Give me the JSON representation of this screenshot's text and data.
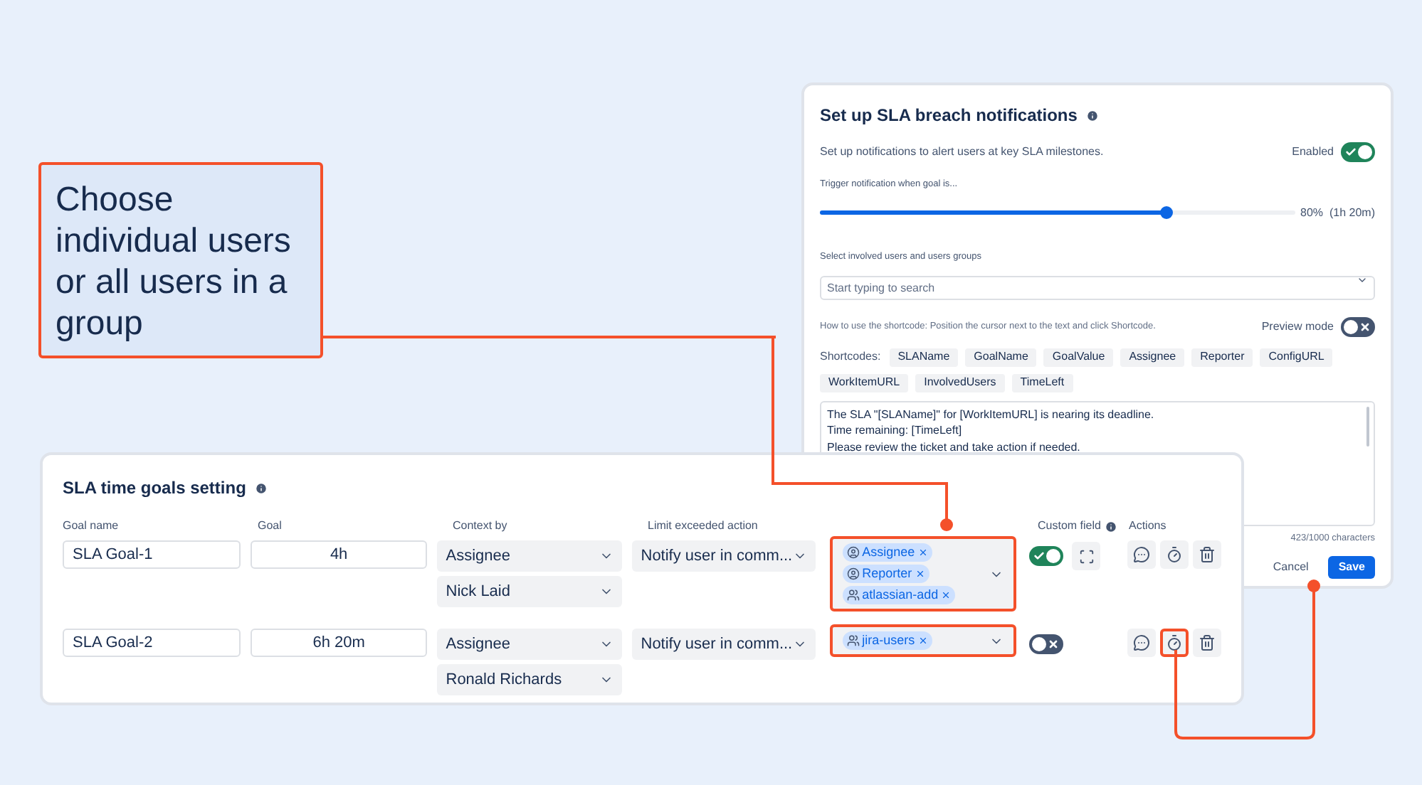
{
  "callout": {
    "text": "Choose individual users or all users in a group"
  },
  "notifications": {
    "title": "Set up SLA breach notifications",
    "description": "Set up notifications to alert users at key SLA milestones.",
    "enabled": {
      "label": "Enabled",
      "on": true
    },
    "trigger": {
      "label": "Trigger notification when goal is...",
      "level": 0.73,
      "reading": "80%  (1h 20m)"
    },
    "users": {
      "label": "Select involved users and users groups",
      "placeholder": "Start typing to search"
    },
    "hint": "How to use the shortcode: Position the cursor next to the text and click Shortcode.",
    "preview": {
      "label": "Preview mode",
      "on": false
    },
    "shortcodes_label": "Shortcodes:",
    "shortcodes": [
      "SLAName",
      "GoalName",
      "GoalValue",
      "Assignee",
      "Reporter",
      "ConfigURL",
      "WorkItemURL",
      "InvolvedUsers",
      "TimeLeft"
    ],
    "message": [
      "The SLA \"[SLAName]\" for [WorkItemURL] is nearing its deadline.",
      "Time remaining: [TimeLeft]",
      "Please review the ticket and take action if needed."
    ],
    "counter": "423/1000 characters",
    "buttons": [
      "Cancel",
      "Save"
    ]
  },
  "goals": {
    "title": "SLA time goals setting",
    "columns": [
      "Goal name",
      "Goal",
      "Context by",
      "Limit exceeded action",
      "Custom field",
      "Actions"
    ],
    "rows": [
      {
        "name": "SLA Goal-1",
        "goal": "4h",
        "context": [
          "Assignee",
          "Nick Laid"
        ],
        "action": "Notify user in comm...",
        "highlighted": true,
        "recipients": [
          {
            "kind": "user",
            "label": "Assignee"
          },
          {
            "kind": "user",
            "label": "Reporter"
          },
          {
            "kind": "group",
            "label": "atlassian-add"
          }
        ],
        "custom_field": true,
        "buttons": [
          {
            "kind": "comment",
            "highlighted": false
          },
          {
            "kind": "timer",
            "highlighted": false
          },
          {
            "kind": "delete",
            "highlighted": false
          }
        ]
      },
      {
        "name": "SLA Goal-2",
        "goal": "6h 20m",
        "context": [
          "Assignee",
          "Ronald Richards"
        ],
        "action": "Notify user in comm...",
        "highlighted": true,
        "recipients": [
          {
            "kind": "group",
            "label": "jira-users"
          }
        ],
        "custom_field": false,
        "buttons": [
          {
            "kind": "comment",
            "highlighted": false
          },
          {
            "kind": "timer",
            "highlighted": true
          },
          {
            "kind": "delete",
            "highlighted": false
          }
        ]
      }
    ]
  }
}
